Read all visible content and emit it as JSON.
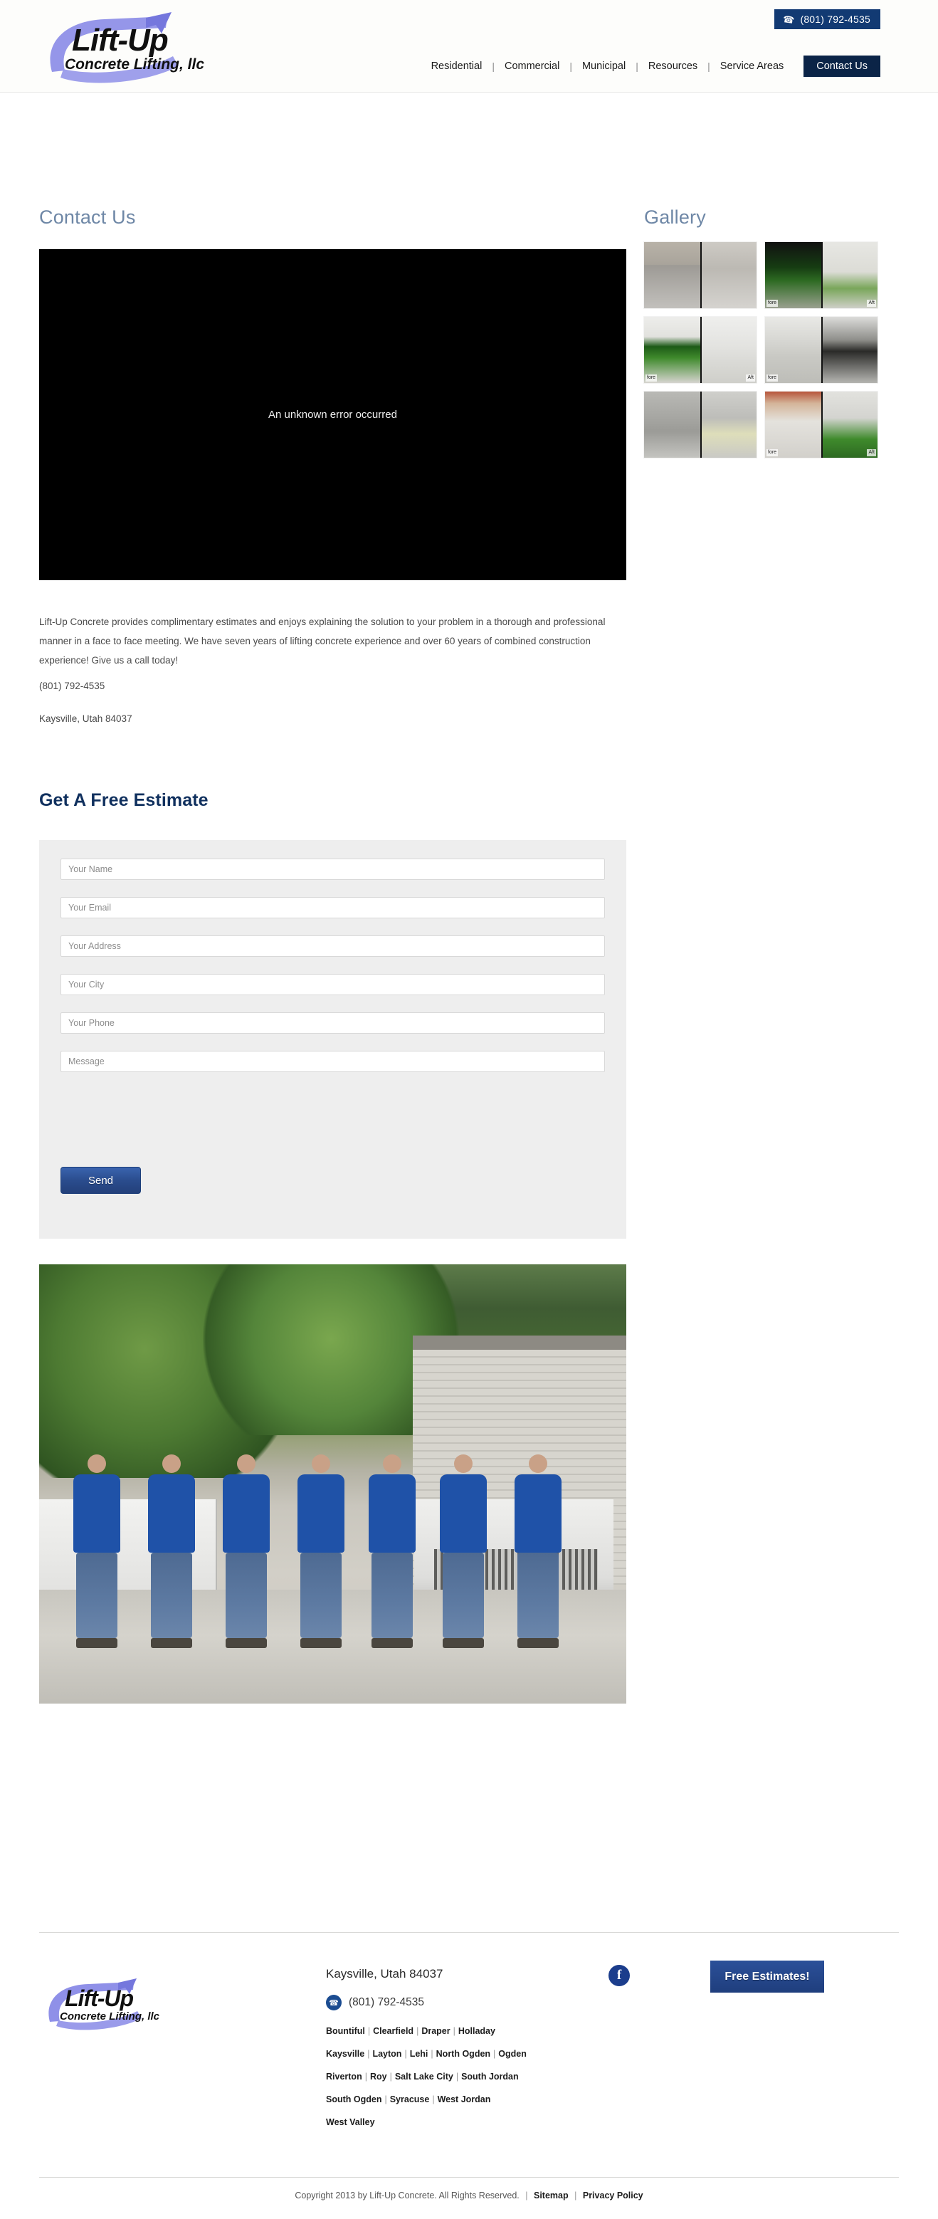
{
  "header": {
    "logo": {
      "line1": "Lift-Up",
      "line2": "Concrete Lifting, llc",
      "swoosh_color": "#7b7de0"
    },
    "phone_button": {
      "icon": "phone-icon",
      "label": "(801) 792-4535",
      "bg": "#123a73"
    },
    "nav": [
      {
        "label": "Residential"
      },
      {
        "label": "Commercial"
      },
      {
        "label": "Municipal"
      },
      {
        "label": "Resources"
      },
      {
        "label": "Service Areas"
      }
    ],
    "nav_separator": "|",
    "contact_button": {
      "label": "Contact Us",
      "bg": "#0b2447"
    }
  },
  "main": {
    "contact_heading": "Contact Us",
    "video": {
      "error_text": "An unknown error occurred"
    },
    "paragraph": "Lift-Up Concrete provides complimentary estimates and enjoys explaining the solution to your problem in a thorough and professional manner in a face to face meeting. We have seven years of lifting concrete experience and over 60 years of combined construction experience! Give us a call today!",
    "phone": "(801) 792-4535",
    "address": "Kaysville, Utah 84037"
  },
  "gallery": {
    "heading": "Gallery",
    "label_before": "fore",
    "label_after": "Aft",
    "items": [
      {
        "name": "gallery-thumb-1",
        "left_class": "ph-concrete-hall",
        "right_class": "ph-concrete-hall2",
        "show_before": false,
        "show_after": false
      },
      {
        "name": "gallery-thumb-2",
        "left_class": "ph-green-dark",
        "right_class": "ph-green-light",
        "show_before": true,
        "show_after": true
      },
      {
        "name": "gallery-thumb-3",
        "left_class": "ph-bush",
        "right_class": "ph-drive",
        "show_before": true,
        "show_after": true
      },
      {
        "name": "gallery-thumb-4",
        "left_class": "ph-house",
        "right_class": "ph-dark-step",
        "show_before": true,
        "show_after": false
      },
      {
        "name": "gallery-thumb-5",
        "left_class": "ph-crack",
        "right_class": "ph-porch",
        "show_before": false,
        "show_after": false
      },
      {
        "name": "gallery-thumb-6",
        "left_class": "ph-warm",
        "right_class": "ph-grass",
        "show_before": true,
        "show_after": true
      }
    ]
  },
  "estimate": {
    "heading": "Get A Free Estimate",
    "fields": [
      {
        "name": "name-field",
        "placeholder": "Your Name"
      },
      {
        "name": "email-field",
        "placeholder": "Your Email"
      },
      {
        "name": "address-field",
        "placeholder": "Your Address"
      },
      {
        "name": "city-field",
        "placeholder": "Your City"
      },
      {
        "name": "phone-field",
        "placeholder": "Your Phone"
      },
      {
        "name": "message-field",
        "placeholder": "Message"
      }
    ],
    "send_label": "Send"
  },
  "footer": {
    "logo": {
      "line1": "Lift-Up",
      "line2": "Concrete Lifting, llc"
    },
    "address": "Kaysville, Utah 84037",
    "phone": "(801) 792-4535",
    "phone_icon": "phone-icon",
    "facebook_icon": "facebook-icon",
    "facebook_glyph": "f",
    "free_estimates_label": "Free Estimates!",
    "city_rows": [
      [
        "Bountiful",
        "Clearfield",
        "Draper",
        "Holladay"
      ],
      [
        "Kaysville",
        "Layton",
        "Lehi",
        "North Ogden",
        "Ogden"
      ],
      [
        "Riverton",
        "Roy",
        "Salt Lake City",
        "South Jordan"
      ],
      [
        "South Ogden",
        "Syracuse",
        "West Jordan"
      ],
      [
        "West Valley"
      ]
    ],
    "city_separator": "|",
    "copyright": "Copyright 2013 by Lift-Up Concrete. All Rights Reserved.",
    "copyright_separator": "|",
    "sitemap_label": "Sitemap",
    "privacy_label": "Privacy Policy"
  }
}
